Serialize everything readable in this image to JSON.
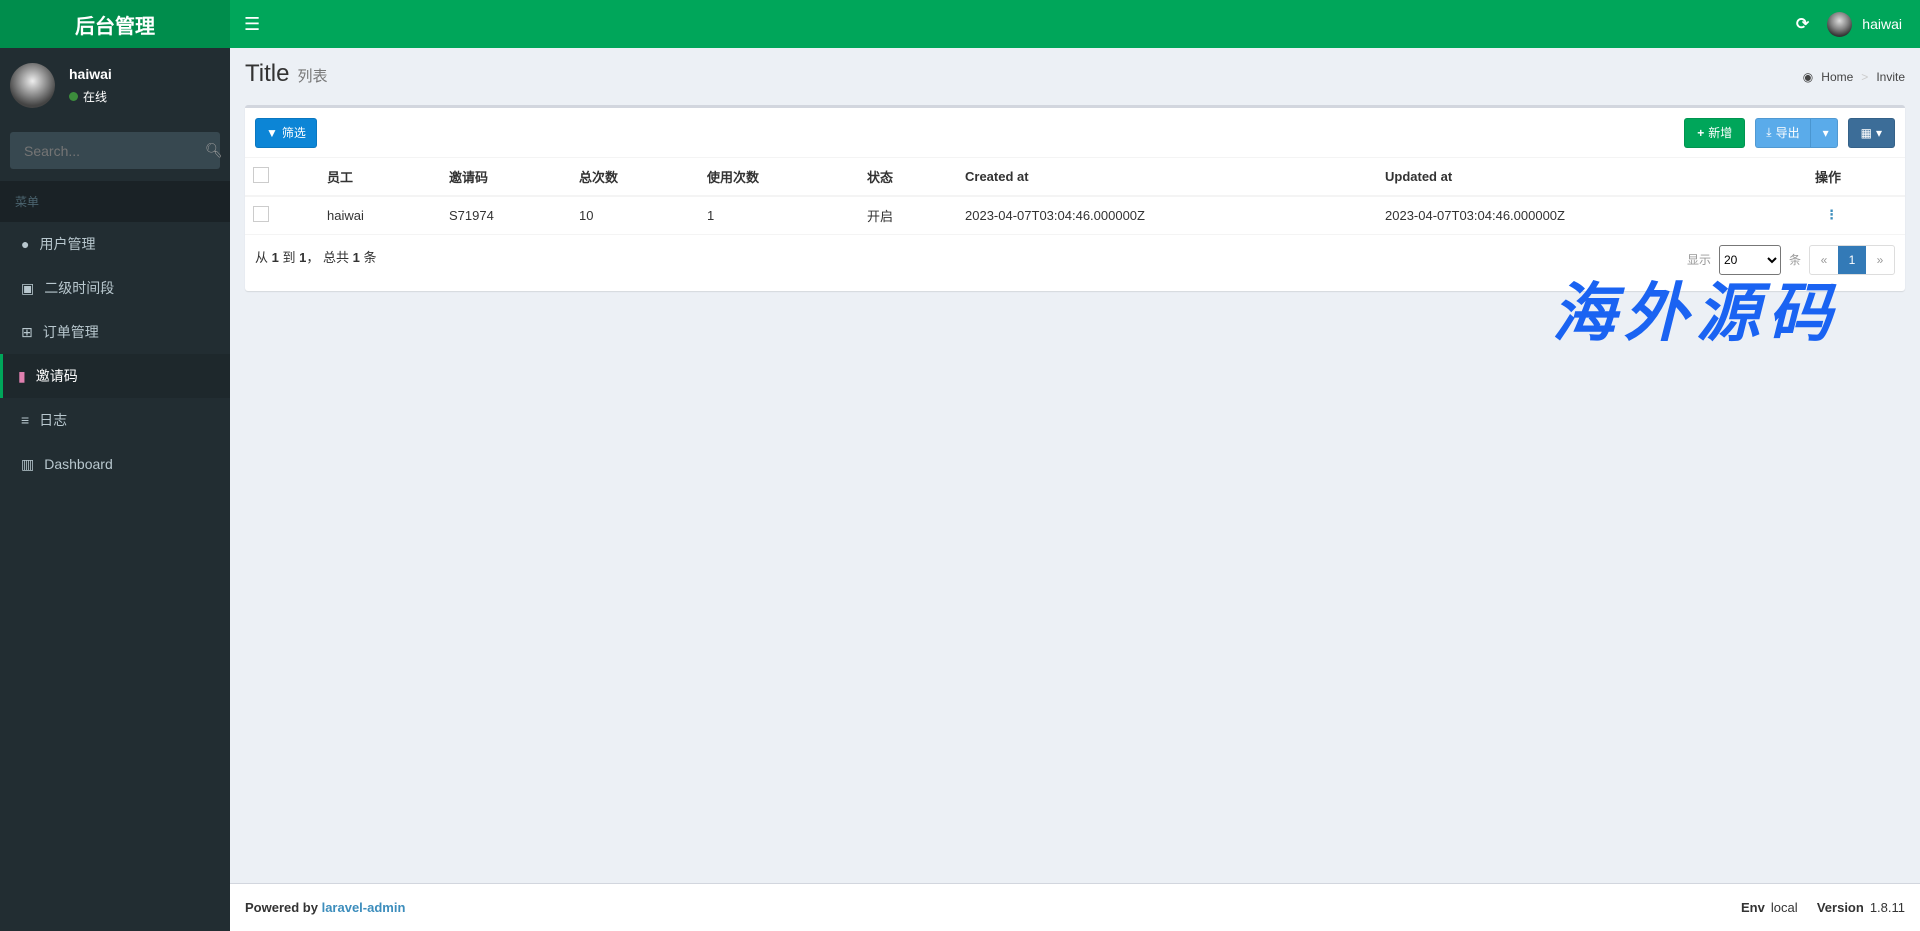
{
  "app": {
    "title": "后台管理",
    "user": "haiwai"
  },
  "sidebar": {
    "user": {
      "name": "haiwai",
      "status": "在线"
    },
    "search_placeholder": "Search...",
    "menu_header": "菜单",
    "items": [
      {
        "label": "用户管理",
        "icon": "user-icon"
      },
      {
        "label": "二级时间段",
        "icon": "calendar-check-icon"
      },
      {
        "label": "订单管理",
        "icon": "cart-icon"
      },
      {
        "label": "邀请码",
        "icon": "invite-icon",
        "active": true
      },
      {
        "label": "日志",
        "icon": "list-icon"
      },
      {
        "label": "Dashboard",
        "icon": "bar-chart-icon"
      }
    ]
  },
  "header": {
    "title": "Title",
    "subtitle": "列表",
    "breadcrumb": [
      "Home",
      "Invite"
    ]
  },
  "toolbar": {
    "filter": "筛选",
    "new": "新增",
    "export": "导出"
  },
  "table": {
    "columns": [
      "员工",
      "邀请码",
      "总次数",
      "使用次数",
      "状态",
      "Created at",
      "Updated at",
      "操作"
    ],
    "rows": [
      [
        "haiwai",
        "S71974",
        "10",
        "1",
        "开启",
        "2023-04-07T03:04:46.000000Z",
        "2023-04-07T03:04:46.000000Z"
      ]
    ]
  },
  "pagination": {
    "from_label": "从",
    "from": "1",
    "to_label": "到",
    "to": "1",
    "total_label": "， 总共",
    "total": "1",
    "unit": "条",
    "show_label": "显示",
    "per_page": "20",
    "per_unit": "条",
    "prev": "«",
    "current": "1",
    "next": "»"
  },
  "watermark": "海外源码",
  "footer": {
    "powered": "Powered by",
    "link": "laravel-admin",
    "env_label": "Env",
    "env": "local",
    "version_label": "Version",
    "version": "1.8.11"
  },
  "colors": {
    "brand": "#00a65a",
    "sidebar": "#222d32",
    "primary": "#337ab7"
  }
}
